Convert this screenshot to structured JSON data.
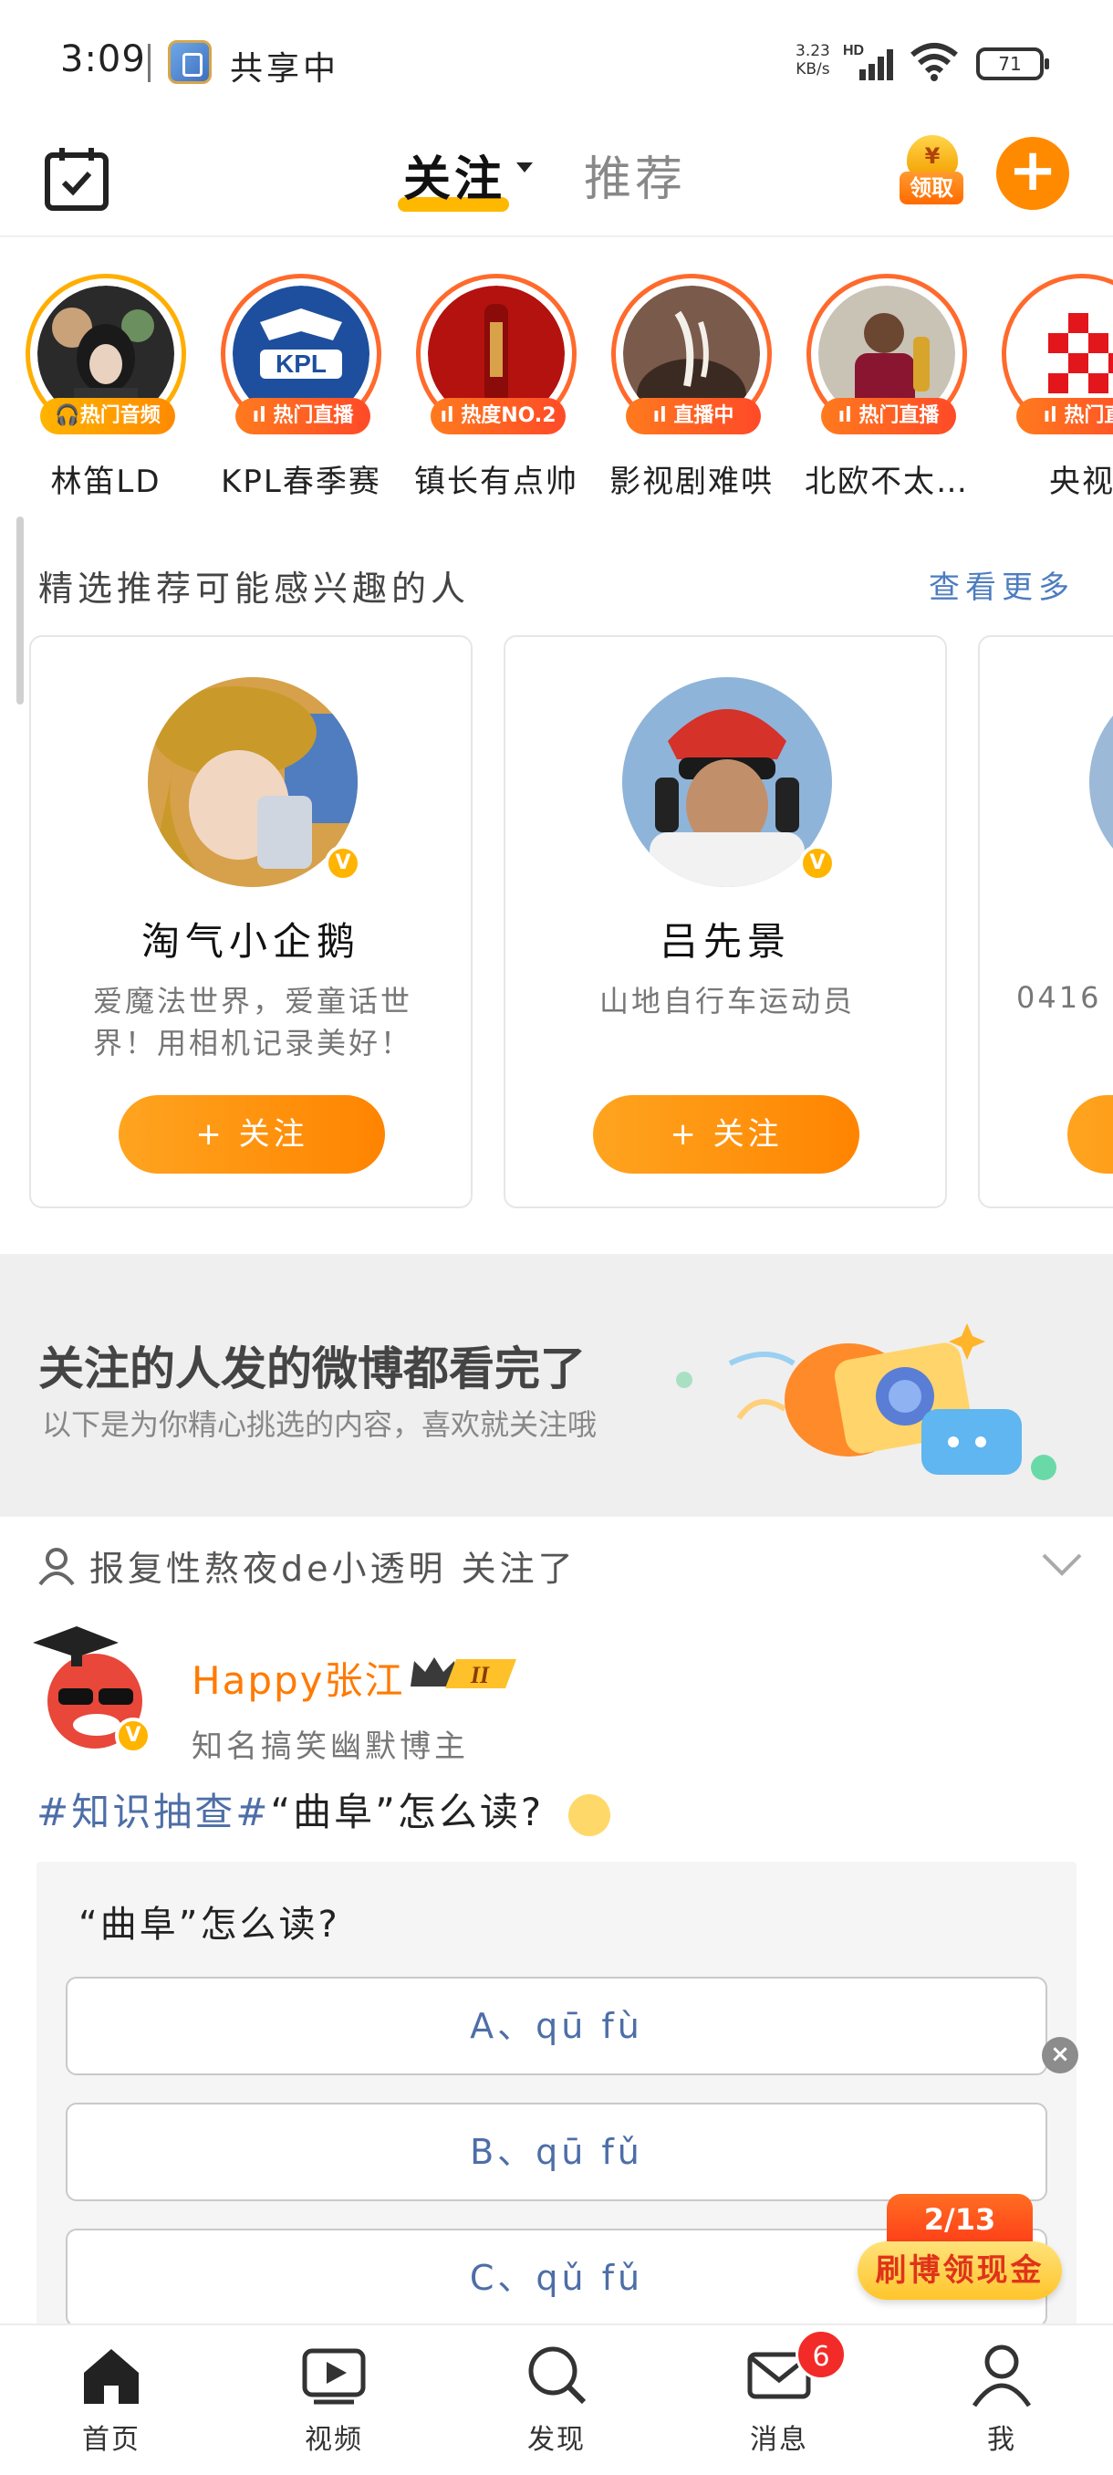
{
  "status_bar": {
    "time": "3:09",
    "share_label": "共享中",
    "net_speed_value": "3.23",
    "net_speed_unit": "KB/s",
    "network": "HD",
    "battery": "71"
  },
  "header": {
    "tab_follow": "关注",
    "tab_recommend": "推荐",
    "reward_label": "领取",
    "reward_coin": "¥",
    "add_label": "+"
  },
  "hot_strip": [
    {
      "badge": "🎧热门音频",
      "name": "林笛LD",
      "ring": "gold"
    },
    {
      "badge": "ıl 热门直播",
      "name": "KPL春季赛",
      "ring": "red"
    },
    {
      "badge": "ıl 热度NO.2",
      "name": "镇长有点帅",
      "ring": "red"
    },
    {
      "badge": "ıl 直播中",
      "name": "影视剧难哄",
      "ring": "red"
    },
    {
      "badge": "ıl 热门直播",
      "name": "北欧不太…",
      "ring": "red"
    },
    {
      "badge": "ıl 热门直",
      "name": "央视",
      "ring": "red"
    }
  ],
  "recommend": {
    "title": "精选推荐可能感兴趣的人",
    "more": "查看更多",
    "cards": [
      {
        "name": "淘气小企鹅",
        "desc": "爱魔法世界，爱童话世界！用相机记录美好！",
        "follow": "+ 关注"
      },
      {
        "name": "吕先景",
        "desc": "山地自行车运动员",
        "follow": "+ 关注"
      },
      {
        "name": "",
        "desc": "0416",
        "follow": ""
      }
    ]
  },
  "banner": {
    "title": "关注的人发的微博都看完了",
    "subtitle": "以下是为你精心挑选的内容，喜欢就关注哦"
  },
  "feed": {
    "context": "报复性熬夜de小透明 关注了",
    "post": {
      "author": "Happy张江",
      "level": "II",
      "author_desc": "知名搞笑幽默博主",
      "topic": "#知识抽查#",
      "text": "“曲阜”怎么读?",
      "quiz": {
        "question": "“曲阜”怎么读?",
        "options": [
          "A、qū fù",
          "B、qū fǔ",
          "C、qǔ fǔ"
        ]
      }
    }
  },
  "cash_widget": {
    "progress": "2/13",
    "label": "刷博领现金"
  },
  "bottom_nav": [
    {
      "label": "首页",
      "icon": "home-icon"
    },
    {
      "label": "视频",
      "icon": "video-icon"
    },
    {
      "label": "发现",
      "icon": "search-icon"
    },
    {
      "label": "消息",
      "icon": "mail-icon",
      "badge": "6"
    },
    {
      "label": "我",
      "icon": "profile-icon"
    }
  ],
  "colors": {
    "accent": "#ff8a00",
    "badge_red": "#ff4a28",
    "link_blue": "#4d7cbf",
    "author_orange": "#ff7a00"
  }
}
